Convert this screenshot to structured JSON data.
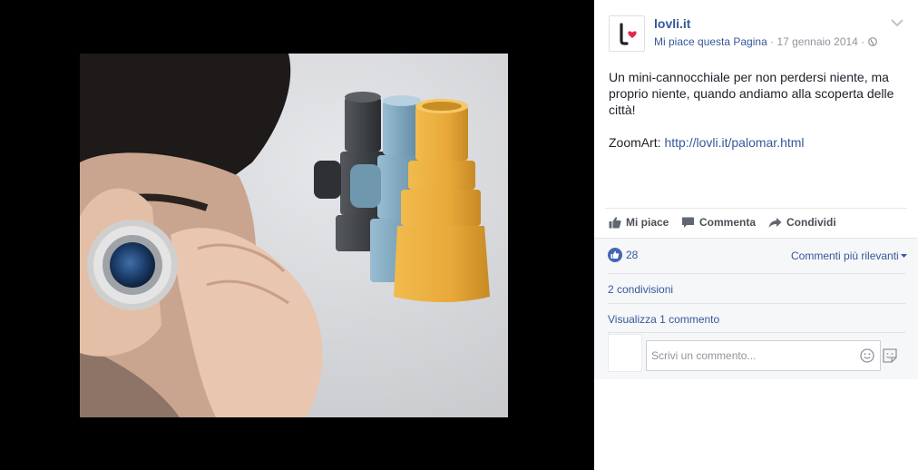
{
  "post": {
    "page_name": "lovli.it",
    "like_page": "Mi piace questa Pagina",
    "separator": "·",
    "date": "17 gennaio 2014",
    "text_line1": "Un mini-cannocchiale per non perdersi niente, ma proprio niente, quando andiamo alla scoperta delle città!",
    "text_prefix": "ZoomArt: ",
    "link": "http://lovli.it/palomar.html"
  },
  "actions": {
    "like": "Mi piace",
    "comment": "Commenta",
    "share": "Condividi"
  },
  "stats": {
    "reactions": "28",
    "sort": "Commenti più rilevanti",
    "shares": "2 condivisioni",
    "view_comments": "Visualizza 1 commento"
  },
  "composer": {
    "placeholder": "Scrivi un commento..."
  },
  "colors": {
    "link": "#365899",
    "like_blue": "#4267b2",
    "heart": "#e02a4d",
    "telescope_black": "#3a3d40",
    "telescope_blue": "#7fa6bd",
    "telescope_yellow": "#e8a93a"
  },
  "icons": [
    "lovli-logo",
    "chevron-down-icon",
    "globe-icon",
    "thumbs-up-icon",
    "comment-icon",
    "share-icon",
    "like-reaction-icon",
    "dropdown-caret-icon",
    "emoji-icon",
    "sticker-icon"
  ]
}
